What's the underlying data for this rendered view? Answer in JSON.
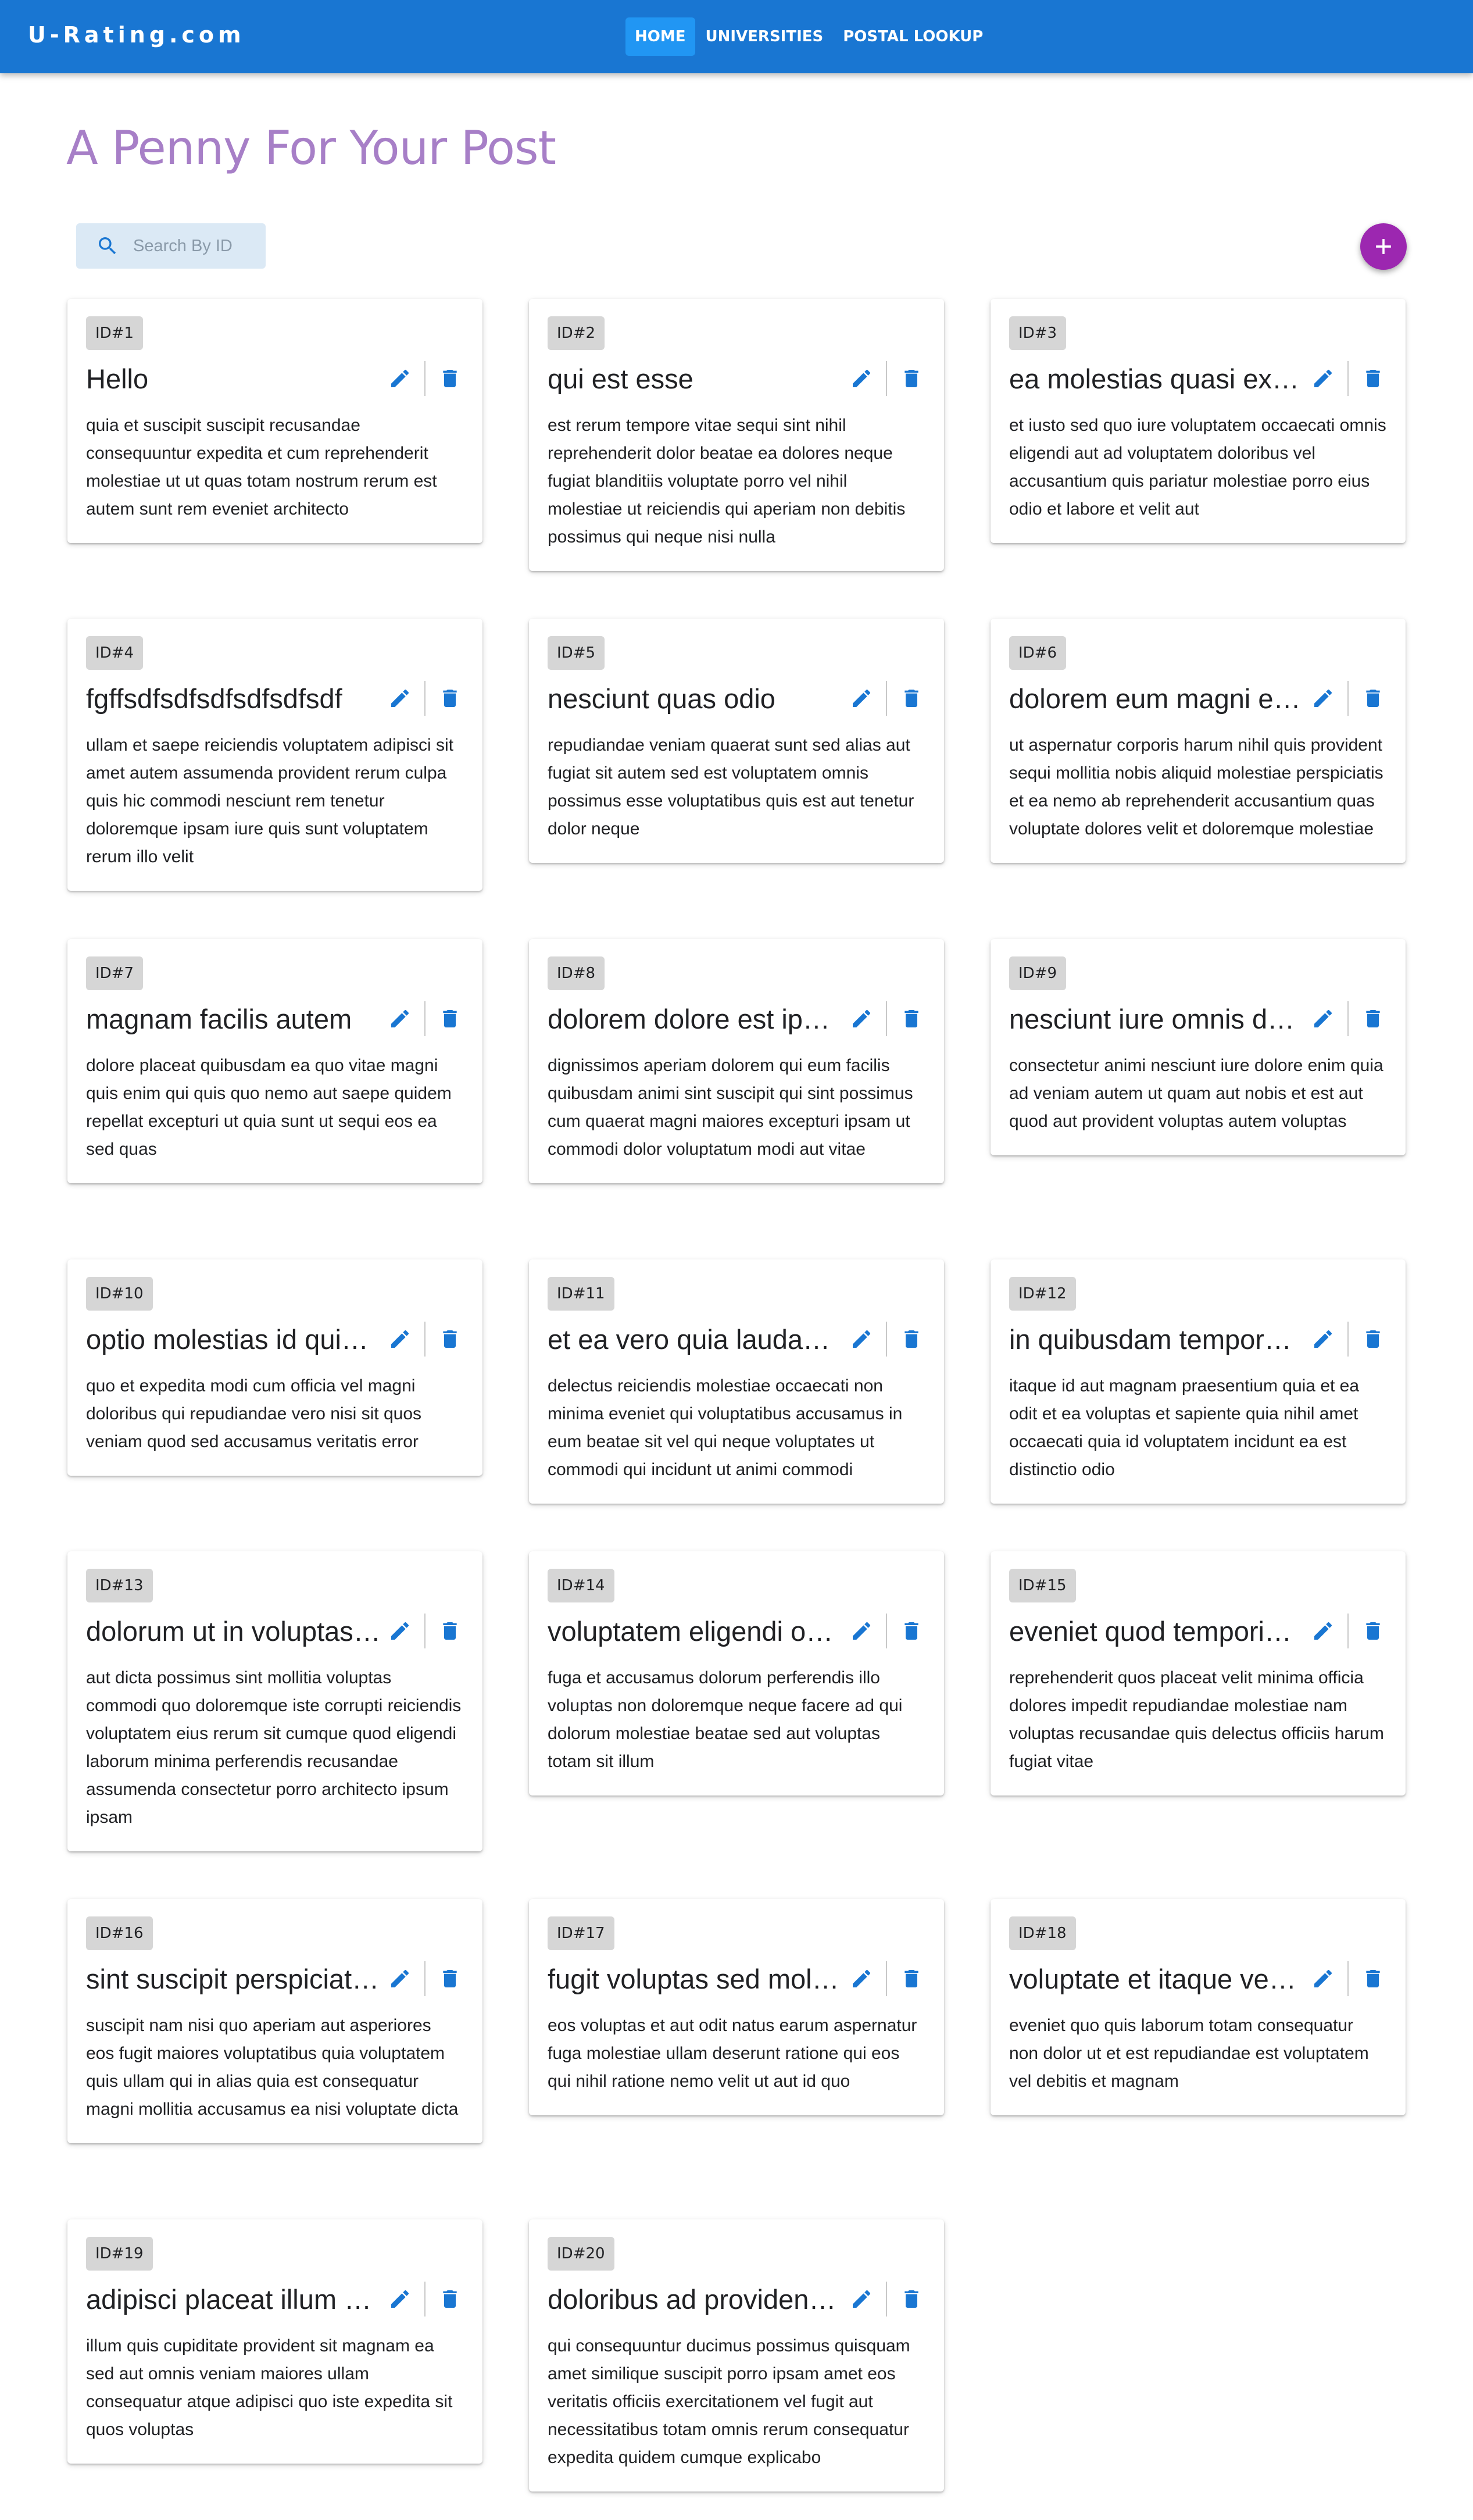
{
  "app": {
    "brand": "U-Rating.com"
  },
  "nav": {
    "home": "HOME",
    "universities": "UNIVERSITIES",
    "postal": "POSTAL LOOKUP"
  },
  "page": {
    "title": "A Penny For Your Post"
  },
  "search": {
    "placeholder": "Search By ID"
  },
  "colors": {
    "appbar": "#1976d2",
    "title": "#a77fc7",
    "fab": "#9c27b0",
    "icon": "#1976d2"
  },
  "icons": {
    "search": "search-icon",
    "add": "plus-icon",
    "edit": "pencil-icon",
    "delete": "trash-icon"
  },
  "posts": [
    {
      "id": "ID#1",
      "title": "Hello",
      "body": "quia et suscipit suscipit recusandae consequuntur expedita et cum reprehenderit molestiae ut ut quas totam nostrum rerum est autem sunt rem eveniet architecto"
    },
    {
      "id": "ID#2",
      "title": "qui est esse",
      "body": "est rerum tempore vitae sequi sint nihil reprehenderit dolor beatae ea dolores neque fugiat blanditiis voluptate porro vel nihil molestiae ut reiciendis qui aperiam non debitis possimus qui neque nisi nulla"
    },
    {
      "id": "ID#3",
      "title": "ea molestias quasi exercitationem repellat qui ipsa sit aut",
      "body": "et iusto sed quo iure voluptatem occaecati omnis eligendi aut ad voluptatem doloribus vel accusantium quis pariatur molestiae porro eius odio et labore et velit aut"
    },
    {
      "id": "ID#4",
      "title": "fgffsdfsdfsdfsdfsdfsdf",
      "body": "ullam et saepe reiciendis voluptatem adipisci sit amet autem assumenda provident rerum culpa quis hic commodi nesciunt rem tenetur doloremque ipsam iure quis sunt voluptatem rerum illo velit"
    },
    {
      "id": "ID#5",
      "title": "nesciunt quas odio",
      "body": "repudiandae veniam quaerat sunt sed alias aut fugiat sit autem sed est voluptatem omnis possimus esse voluptatibus quis est aut tenetur dolor neque"
    },
    {
      "id": "ID#6",
      "title": "dolorem eum magni eos aperiam quia",
      "body": "ut aspernatur corporis harum nihil quis provident sequi mollitia nobis aliquid molestiae perspiciatis et ea nemo ab reprehenderit accusantium quas voluptate dolores velit et doloremque molestiae"
    },
    {
      "id": "ID#7",
      "title": "magnam facilis autem",
      "body": "dolore placeat quibusdam ea quo vitae magni quis enim qui quis quo nemo aut saepe quidem repellat excepturi ut quia sunt ut sequi eos ea sed quas"
    },
    {
      "id": "ID#8",
      "title": "dolorem dolore est ipsam",
      "body": "dignissimos aperiam dolorem qui eum facilis quibusdam animi sint suscipit qui sint possimus cum quaerat magni maiores excepturi ipsam ut commodi dolor voluptatum modi aut vitae"
    },
    {
      "id": "ID#9",
      "title": "nesciunt iure omnis dolorem tempora et accusantium",
      "body": "consectetur animi nesciunt iure dolore enim quia ad veniam autem ut quam aut nobis et est aut quod aut provident voluptas autem voluptas"
    },
    {
      "id": "ID#10",
      "title": "optio molestias id quia eum",
      "body": "quo et expedita modi cum officia vel magni doloribus qui repudiandae vero nisi sit quos veniam quod sed accusamus veritatis error"
    },
    {
      "id": "ID#11",
      "title": "et ea vero quia laudantium autem",
      "body": "delectus reiciendis molestiae occaecati non minima eveniet qui voluptatibus accusamus in eum beatae sit vel qui neque voluptates ut commodi qui incidunt ut animi commodi"
    },
    {
      "id": "ID#12",
      "title": "in quibusdam tempore odit est dolorem",
      "body": "itaque id aut magnam praesentium quia et ea odit et ea voluptas et sapiente quia nihil amet occaecati quia id voluptatem incidunt ea est distinctio odio"
    },
    {
      "id": "ID#13",
      "title": "dolorum ut in voluptas mollitia et saepe quo animi",
      "body": "aut dicta possimus sint mollitia voluptas commodi quo doloremque iste corrupti reiciendis voluptatem eius rerum sit cumque quod eligendi laborum minima perferendis recusandae assumenda consectetur porro architecto ipsum ipsam"
    },
    {
      "id": "ID#14",
      "title": "voluptatem eligendi optio",
      "body": "fuga et accusamus dolorum perferendis illo voluptas non doloremque neque facere ad qui dolorum molestiae beatae sed aut voluptas totam sit illum"
    },
    {
      "id": "ID#15",
      "title": "eveniet quod temporibus",
      "body": "reprehenderit quos placeat velit minima officia dolores impedit repudiandae molestiae nam voluptas recusandae quis delectus officiis harum fugiat vitae"
    },
    {
      "id": "ID#16",
      "title": "sint suscipit perspiciatis velit dolorum rerum ipsa laboriosam odio",
      "body": "suscipit nam nisi quo aperiam aut asperiores eos fugit maiores voluptatibus quia voluptatem quis ullam qui in alias quia est consequatur magni mollitia accusamus ea nisi voluptate dicta"
    },
    {
      "id": "ID#17",
      "title": "fugit voluptas sed molestias voluptatem provident",
      "body": "eos voluptas et aut odit natus earum aspernatur fuga molestiae ullam deserunt ratione qui eos qui nihil ratione nemo velit ut aut id quo"
    },
    {
      "id": "ID#18",
      "title": "voluptate et itaque vero tempora molestiae",
      "body": "eveniet quo quis laborum totam consequatur non dolor ut et est repudiandae est voluptatem vel debitis et magnam"
    },
    {
      "id": "ID#19",
      "title": "adipisci placeat illum aut reiciendis qui",
      "body": "illum quis cupiditate provident sit magnam ea sed aut omnis veniam maiores ullam consequatur atque adipisci quo iste expedita sit quos voluptas"
    },
    {
      "id": "ID#20",
      "title": "doloribus ad provident suscipit at",
      "body": "qui consequuntur ducimus possimus quisquam amet similique suscipit porro ipsam amet eos veritatis officiis exercitationem vel fugit aut necessitatibus totam omnis rerum consequatur expedita quidem cumque explicabo"
    }
  ]
}
